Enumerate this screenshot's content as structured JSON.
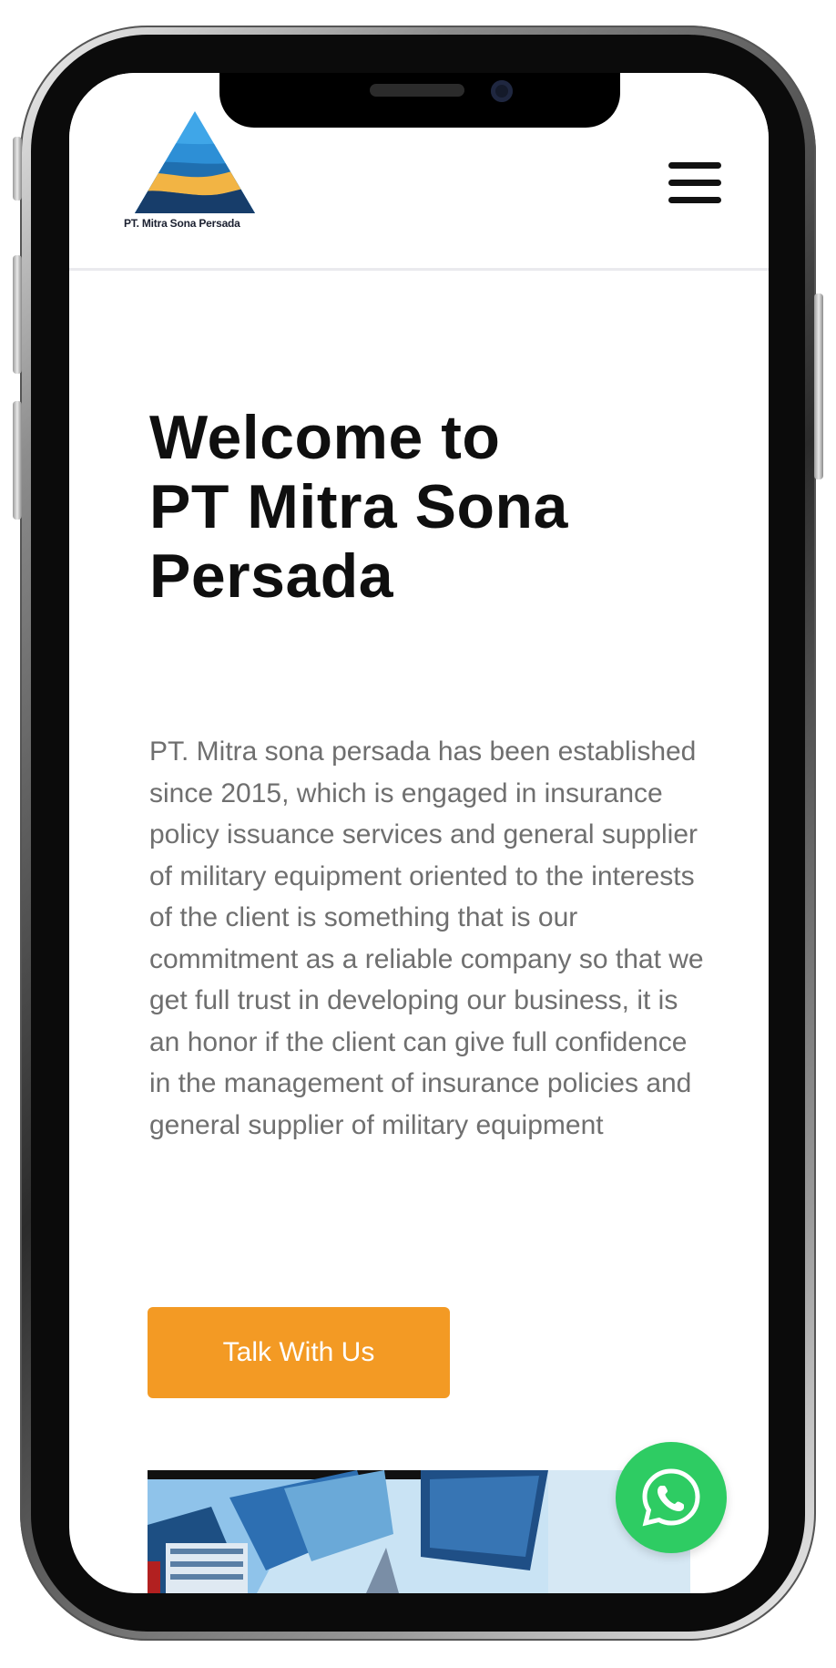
{
  "brand": {
    "logo_text": "PT. Mitra Sona Persada",
    "colors": {
      "accent": "#f39a24",
      "whatsapp": "#2ecc63",
      "logo_blue": "#2d8fd6",
      "logo_navy": "#173d6a",
      "logo_gold": "#f2b444"
    }
  },
  "header": {
    "menu_icon": "hamburger-menu-icon"
  },
  "hero": {
    "title_lines": [
      "Welcome to",
      "PT Mitra Sona",
      "Persada"
    ],
    "description": "PT. Mitra sona persada has been established since 2015, which is engaged in insurance policy issuance services and general supplier of military equipment oriented to the interests of the client is something that is our commitment as a reliable company so that we get full trust in developing our business, it is an honor if the client can give full confidence in the management of insurance policies and general supplier of military equipment",
    "cta_label": "Talk With Us"
  },
  "floating": {
    "whatsapp_icon": "whatsapp-icon"
  }
}
